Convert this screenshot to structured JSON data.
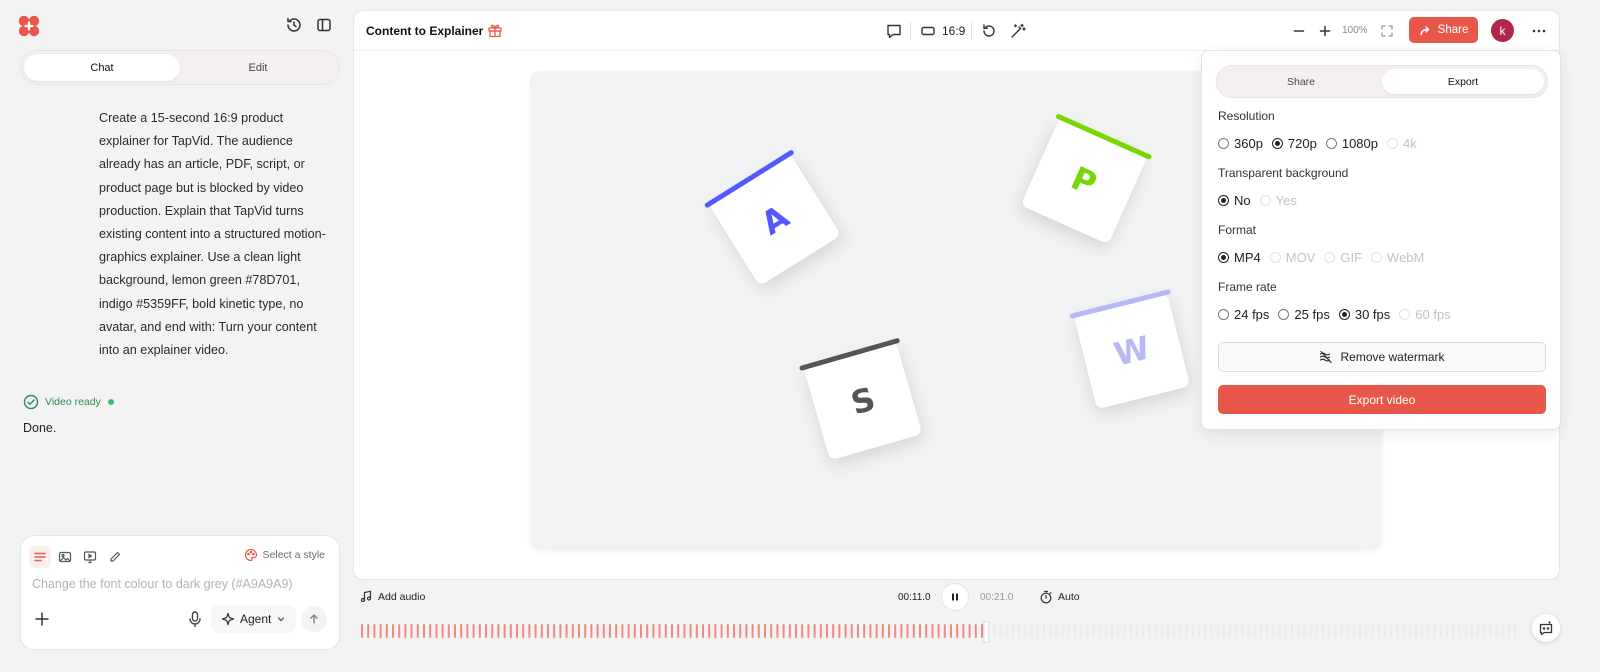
{
  "sidebar": {
    "tabs": [
      {
        "label": "Chat",
        "active": true
      },
      {
        "label": "Edit",
        "active": false
      }
    ],
    "prompt": "Create a 15-second 16:9 product explainer for TapVid. The audience already has an article, PDF, script, or product page but is blocked by video production. Explain that TapVid turns existing content into a structured motion-graphics explainer. Use a clean light background, lemon green #78D701, indigo #5359FF, bold kinetic type, no avatar, and end with: Turn your content into an explainer video.",
    "status": "Video ready",
    "reply": "Done.",
    "composer": {
      "style_label": "Select a style",
      "placeholder": "Change the font colour to dark grey (#A9A9A9)",
      "agent_label": "Agent"
    }
  },
  "header": {
    "title": "Content to Explainer",
    "ratio": "16:9",
    "zoom": "100%",
    "share_label": "Share",
    "avatar_initial": "k"
  },
  "canvas": {
    "cards": [
      {
        "letter": "A",
        "color": "#5359FF"
      },
      {
        "letter": "P",
        "color": "#78D701"
      },
      {
        "letter": "S",
        "color": "#555555"
      },
      {
        "letter": "W",
        "color": "#B8B9F4"
      }
    ]
  },
  "export_panel": {
    "tabs": [
      {
        "label": "Share",
        "active": false
      },
      {
        "label": "Export",
        "active": true
      }
    ],
    "resolution": {
      "label": "Resolution",
      "options": [
        "360p",
        "720p",
        "1080p",
        "4k"
      ],
      "selected": "720p",
      "disabled": [
        "4k"
      ]
    },
    "transparent": {
      "label": "Transparent background",
      "options": [
        "No",
        "Yes"
      ],
      "selected": "No",
      "disabled": [
        "Yes"
      ]
    },
    "format": {
      "label": "Format",
      "options": [
        "MP4",
        "MOV",
        "GIF",
        "WebM"
      ],
      "selected": "MP4",
      "disabled": [
        "MOV",
        "GIF",
        "WebM"
      ]
    },
    "frame_rate": {
      "label": "Frame rate",
      "options": [
        "24 fps",
        "25 fps",
        "30 fps",
        "60 fps"
      ],
      "selected": "30 fps",
      "disabled": [
        "60 fps"
      ]
    },
    "watermark_label": "Remove watermark",
    "export_label": "Export video"
  },
  "timeline": {
    "add_audio_label": "Add audio",
    "current_time": "00:11.0",
    "total_time": "00:21.0",
    "auto_label": "Auto",
    "progress": 0.536
  },
  "colors": {
    "accent": "#E8584A",
    "indigo": "#5359FF",
    "lemon_green": "#78D701",
    "ready_green": "#2E8A56"
  }
}
